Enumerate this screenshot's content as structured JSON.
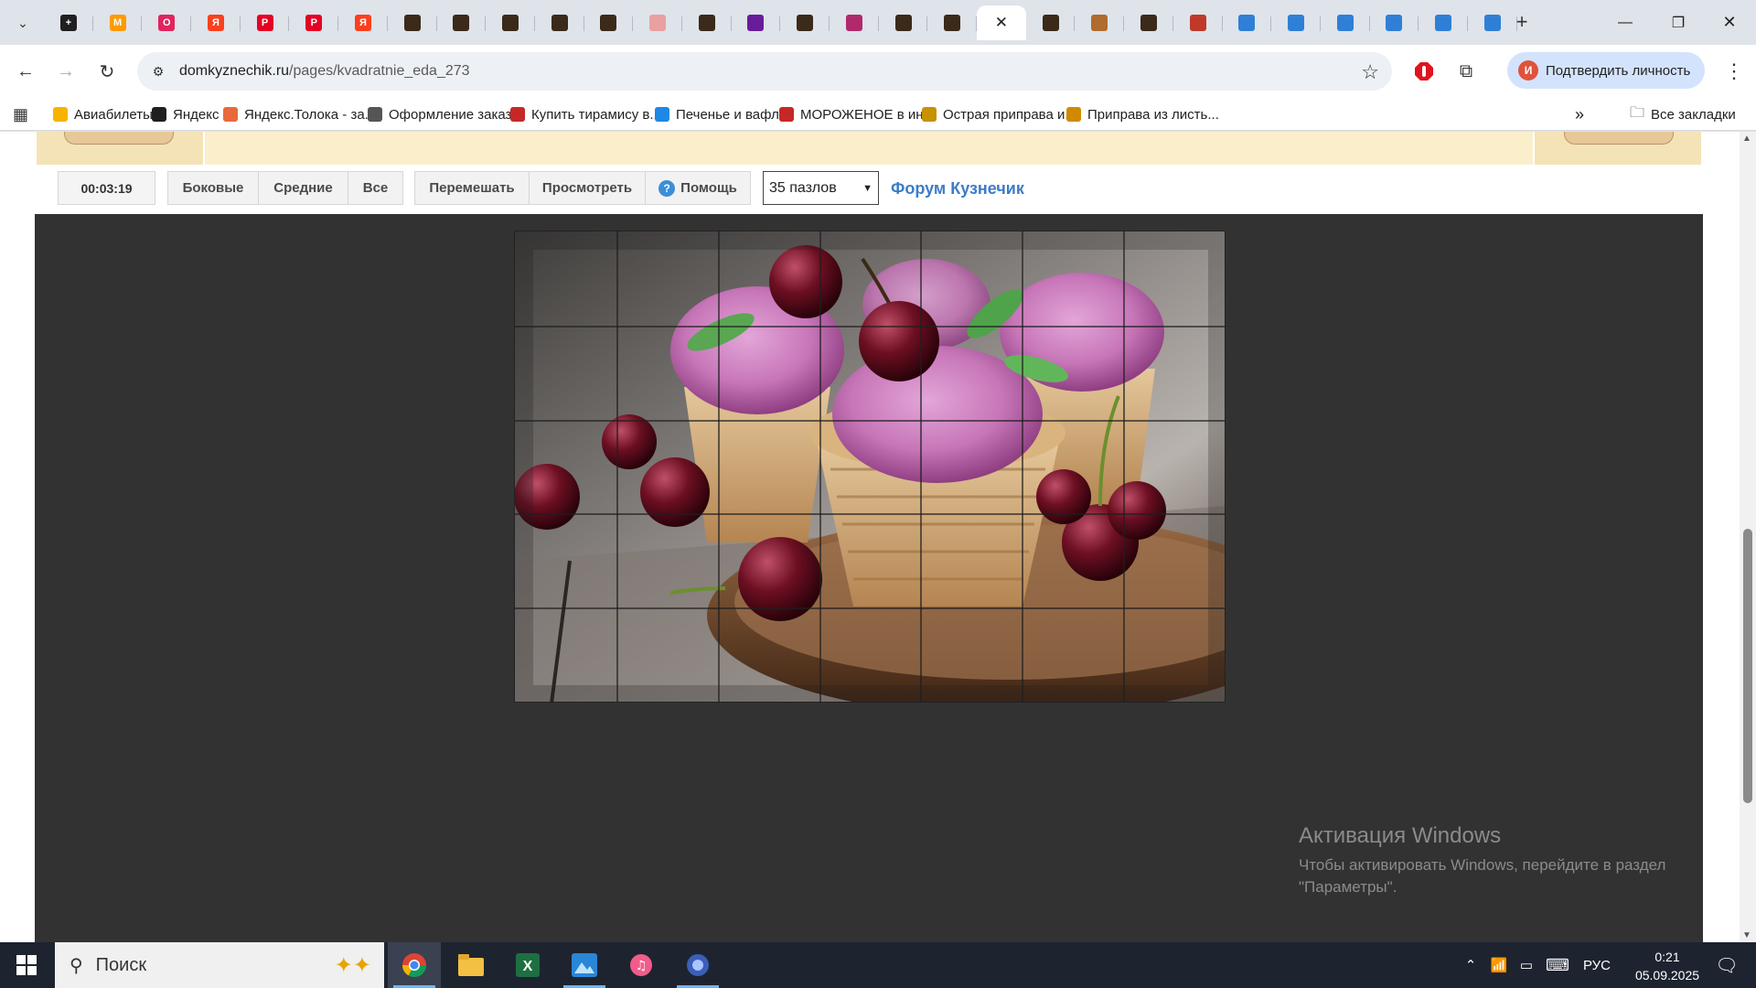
{
  "browser": {
    "tabs": [
      {
        "icon": "plus-square-icon",
        "color": "#1f1f1f",
        "glyph": "+"
      },
      {
        "icon": "yandex-market-icon",
        "color": "#ff9a00",
        "glyph": "M"
      },
      {
        "icon": "ozon-icon",
        "color": "#e0245e",
        "glyph": "O"
      },
      {
        "icon": "yandex-icon",
        "color": "#fc3f1d",
        "glyph": "Я"
      },
      {
        "icon": "pinterest-icon",
        "color": "#e60023",
        "glyph": "P"
      },
      {
        "icon": "pinterest-icon",
        "color": "#e60023",
        "glyph": "P"
      },
      {
        "icon": "yandex-icon",
        "color": "#fc3f1d",
        "glyph": "Я"
      },
      {
        "icon": "site-favicon-icon",
        "color": "#3b2a1a",
        "glyph": ""
      },
      {
        "icon": "site-favicon-icon",
        "color": "#3b2a1a",
        "glyph": ""
      },
      {
        "icon": "site-favicon-icon",
        "color": "#3b2a1a",
        "glyph": ""
      },
      {
        "icon": "site-favicon-icon",
        "color": "#3b2a1a",
        "glyph": ""
      },
      {
        "icon": "site-favicon-icon",
        "color": "#3b2a1a",
        "glyph": ""
      },
      {
        "icon": "cake-icon",
        "color": "#e9a0a0",
        "glyph": ""
      },
      {
        "icon": "site-favicon-icon",
        "color": "#3b2a1a",
        "glyph": ""
      },
      {
        "icon": "purple-grid-icon",
        "color": "#6a1b9a",
        "glyph": ""
      },
      {
        "icon": "site-favicon-icon",
        "color": "#3b2a1a",
        "glyph": ""
      },
      {
        "icon": "pink-swirl-icon",
        "color": "#b02a6b",
        "glyph": ""
      },
      {
        "icon": "site-favicon-icon",
        "color": "#3b2a1a",
        "glyph": ""
      },
      {
        "icon": "site-favicon-icon",
        "color": "#3b2a1a",
        "glyph": ""
      },
      {
        "icon": "close-icon",
        "color": "",
        "glyph": "✕",
        "active": true
      },
      {
        "icon": "site-favicon-icon",
        "color": "#3b2a1a",
        "glyph": ""
      },
      {
        "icon": "squirrel-icon",
        "color": "#b06b2f",
        "glyph": ""
      },
      {
        "icon": "site-favicon-icon",
        "color": "#3b2a1a",
        "glyph": ""
      },
      {
        "icon": "red-fox-icon",
        "color": "#c0392b",
        "glyph": ""
      },
      {
        "icon": "blue-doc-icon",
        "color": "#2f7fd6",
        "glyph": ""
      },
      {
        "icon": "blue-doc-icon",
        "color": "#2f7fd6",
        "glyph": ""
      },
      {
        "icon": "blue-doc-icon",
        "color": "#2f7fd6",
        "glyph": ""
      },
      {
        "icon": "blue-doc-icon",
        "color": "#2f7fd6",
        "glyph": ""
      },
      {
        "icon": "blue-doc-icon",
        "color": "#2f7fd6",
        "glyph": ""
      },
      {
        "icon": "blue-doc-icon",
        "color": "#2f7fd6",
        "glyph": ""
      }
    ],
    "url_host": "domkyznechik.ru",
    "url_path": "/pages/kvadratnie_eda_273",
    "verify_label": "Подтвердить личность",
    "avatar_letter": "И",
    "bookmarks": [
      {
        "label": "Авиабилеты",
        "icon": "plane-icon",
        "color": "#f6b400"
      },
      {
        "label": "Яндекс",
        "icon": "yandex-plus-icon",
        "color": "#1f1f1f"
      },
      {
        "label": "Яндекс.Толока - за...",
        "icon": "toloka-icon",
        "color": "#e86a3a"
      },
      {
        "label": "Оформление заказ...",
        "icon": "globe-icon",
        "color": "#555555"
      },
      {
        "label": "Купить тирамису в...",
        "icon": "tiramisu-icon",
        "color": "#c62828"
      },
      {
        "label": "Печенье и вафли",
        "icon": "basket-icon",
        "color": "#1e88e5"
      },
      {
        "label": "МОРОЖЕНОЕ в ин...",
        "icon": "d-icon",
        "color": "#c62828"
      },
      {
        "label": "Острая приправа и...",
        "icon": "spice-icon",
        "color": "#c79100"
      },
      {
        "label": "Приправа из листь...",
        "icon": "herb-icon",
        "color": "#d08a00"
      }
    ],
    "all_bookmarks_label": "Все закладки"
  },
  "puzzle_page": {
    "timer": "00:03:19",
    "buttons": {
      "side": "Боковые",
      "middle": "Средние",
      "all": "Все",
      "shuffle": "Перемешать",
      "preview": "Просмотреть",
      "help": "Помощь"
    },
    "pieces_select": "35 пазлов",
    "forum_link": "Форум Кузнечик",
    "grid_cols": 7,
    "grid_rows": 5
  },
  "watermark": {
    "title": "Активация Windows",
    "line1": "Чтобы активировать Windows, перейдите в раздел",
    "line2": "\"Параметры\"."
  },
  "taskbar": {
    "search_placeholder": "Поиск",
    "language": "РУС",
    "time": "0:21",
    "date": "05.09.2025"
  }
}
